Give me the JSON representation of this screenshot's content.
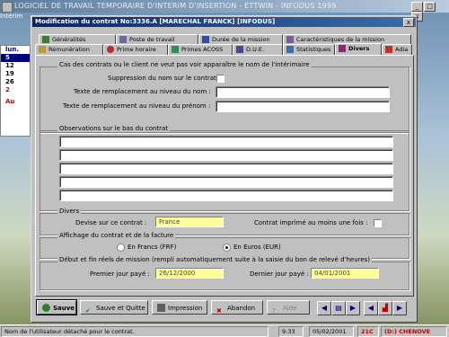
{
  "app": {
    "title": "LOGICIEL DE TRAVAIL TEMPORAIRE D'INTERIM D'INSERTION - ETTWIN - INFODUS 1999",
    "menu": "Intérim",
    "calendar": {
      "day_header": "lun.",
      "rows": [
        "5",
        "12",
        "19",
        "26",
        "2"
      ],
      "highlight": "5",
      "footer": "Au"
    }
  },
  "dialog": {
    "title": "Modification du contrat No:3336.A    [MARECHAL FRANCK] [INFODUS]",
    "close_label": "x"
  },
  "tabs_row1": [
    {
      "label": "Généralités"
    },
    {
      "label": "Poste de travail"
    },
    {
      "label": "Durée de la mission"
    },
    {
      "label": "Caractéristiques de la mission"
    }
  ],
  "tabs_row2": [
    {
      "label": "Rémunération"
    },
    {
      "label": "Prime horaire"
    },
    {
      "label": "Primes ACOSS"
    },
    {
      "label": "D.U.E."
    },
    {
      "label": "Statistiques"
    },
    {
      "label": "Divers"
    },
    {
      "label": "Adia"
    }
  ],
  "anonymity": {
    "heading": "Cas des contrats ou le client ne veut pas voir apparaître le nom de l'intérimaire",
    "suppress_label": "Suppression du nom sur le contrat :",
    "suppress_checked": false,
    "name_label": "Texte de remplacement au niveau du nom :",
    "name_value": "",
    "firstname_label": "Texte de remplacement au niveau du prénom :",
    "firstname_value": ""
  },
  "observations": {
    "heading": "Observations sur le bas du contrat",
    "lines": [
      "",
      "",
      "",
      "",
      ""
    ]
  },
  "divers": {
    "heading": "Divers",
    "currency_label": "Devise sur ce contrat :",
    "currency_value": "France",
    "printed_label": "Contrat imprimé au moins une fois :",
    "printed_checked": false
  },
  "display": {
    "heading": "Affichage du contrat et de la facture",
    "opt_francs": "En Francs (FRF)",
    "opt_euros": "En Euros (EUR)",
    "selected": "euros"
  },
  "mission": {
    "heading": "Début et fin réels de mission (rempli automatiquement suite à la saisie du bon de relevé d'heures)",
    "first_day_label": "Premier jour payé :",
    "first_day_value": "26/12/2000",
    "last_day_label": "Dernier jour payé :",
    "last_day_value": "04/01/2001"
  },
  "buttons": {
    "save": "Sauve",
    "save_quit": "Sauve et Quitte",
    "print": "Impression",
    "abandon": "Abandon",
    "help": "Aide"
  },
  "status": {
    "message": "Nom de l'utilisateur détaché pour le contrat.",
    "time": "9:33",
    "date": "05/02/2001",
    "code": "21C",
    "location": "(D:) CHENOVE"
  },
  "colors": {
    "accent": "#0a246a",
    "field_yellow": "#ffff99",
    "status_red": "#c00000"
  }
}
